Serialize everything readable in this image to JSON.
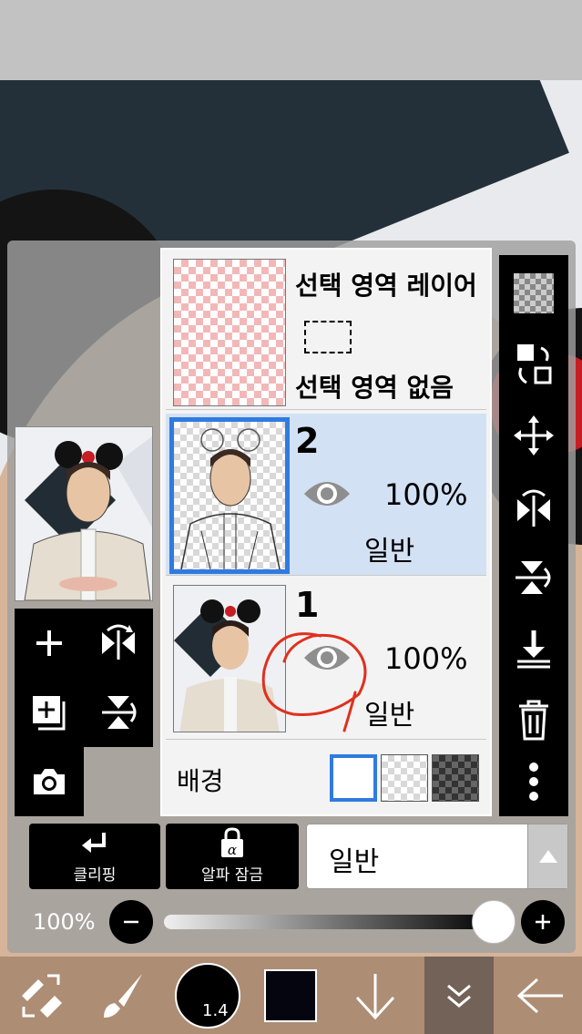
{
  "layers_panel": {
    "selection_layer": {
      "title": "선택 영역 레이어",
      "status": "선택 영역 없음"
    },
    "layers": [
      {
        "name": "2",
        "opacity": "100%",
        "blend": "일반",
        "selected": true
      },
      {
        "name": "1",
        "opacity": "100%",
        "blend": "일반",
        "selected": false
      }
    ],
    "background": {
      "label": "배경"
    }
  },
  "bottom_controls": {
    "clipping_label": "클리핑",
    "alpha_lock_label": "알파 잠금",
    "blend_mode_value": "일반",
    "opacity_label": "100%",
    "opacity_value": 1.0
  },
  "toolbar": {
    "brush_size": "1.4",
    "color": "#050510"
  },
  "colors": {
    "accent": "#2f7be0",
    "selected_layer_bg": "#d3e1f4",
    "annotation_red": "#e0301e"
  }
}
